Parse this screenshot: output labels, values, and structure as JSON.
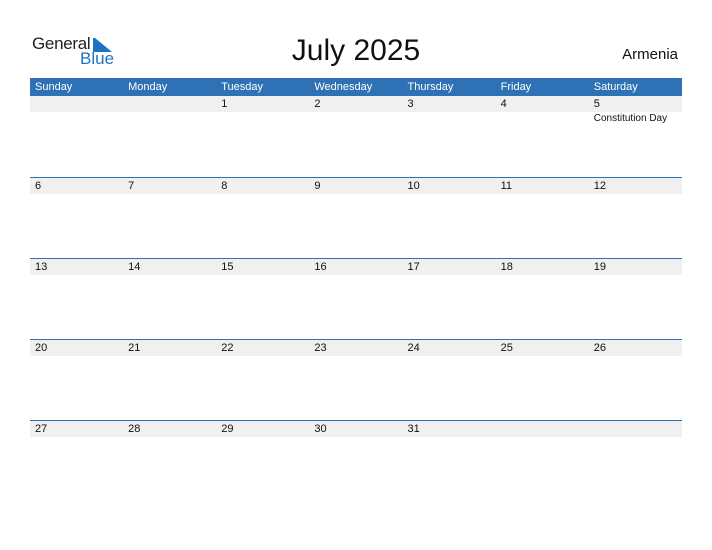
{
  "logo": {
    "general": "General",
    "blue": "Blue"
  },
  "header": {
    "title": "July 2025",
    "country": "Armenia"
  },
  "weekdays": [
    "Sunday",
    "Monday",
    "Tuesday",
    "Wednesday",
    "Thursday",
    "Friday",
    "Saturday"
  ],
  "weeks": [
    {
      "days": [
        "",
        "",
        "1",
        "2",
        "3",
        "4",
        "5"
      ],
      "events": [
        "",
        "",
        "",
        "",
        "",
        "",
        "Constitution Day"
      ]
    },
    {
      "days": [
        "6",
        "7",
        "8",
        "9",
        "10",
        "11",
        "12"
      ],
      "events": [
        "",
        "",
        "",
        "",
        "",
        "",
        ""
      ]
    },
    {
      "days": [
        "13",
        "14",
        "15",
        "16",
        "17",
        "18",
        "19"
      ],
      "events": [
        "",
        "",
        "",
        "",
        "",
        "",
        ""
      ]
    },
    {
      "days": [
        "20",
        "21",
        "22",
        "23",
        "24",
        "25",
        "26"
      ],
      "events": [
        "",
        "",
        "",
        "",
        "",
        "",
        ""
      ]
    },
    {
      "days": [
        "27",
        "28",
        "29",
        "30",
        "31",
        "",
        ""
      ],
      "events": [
        "",
        "",
        "",
        "",
        "",
        "",
        ""
      ]
    }
  ],
  "colors": {
    "header_bg": "#2e72b5",
    "brand_blue": "#1a73c4",
    "day_strip": "#f0f0f0"
  }
}
